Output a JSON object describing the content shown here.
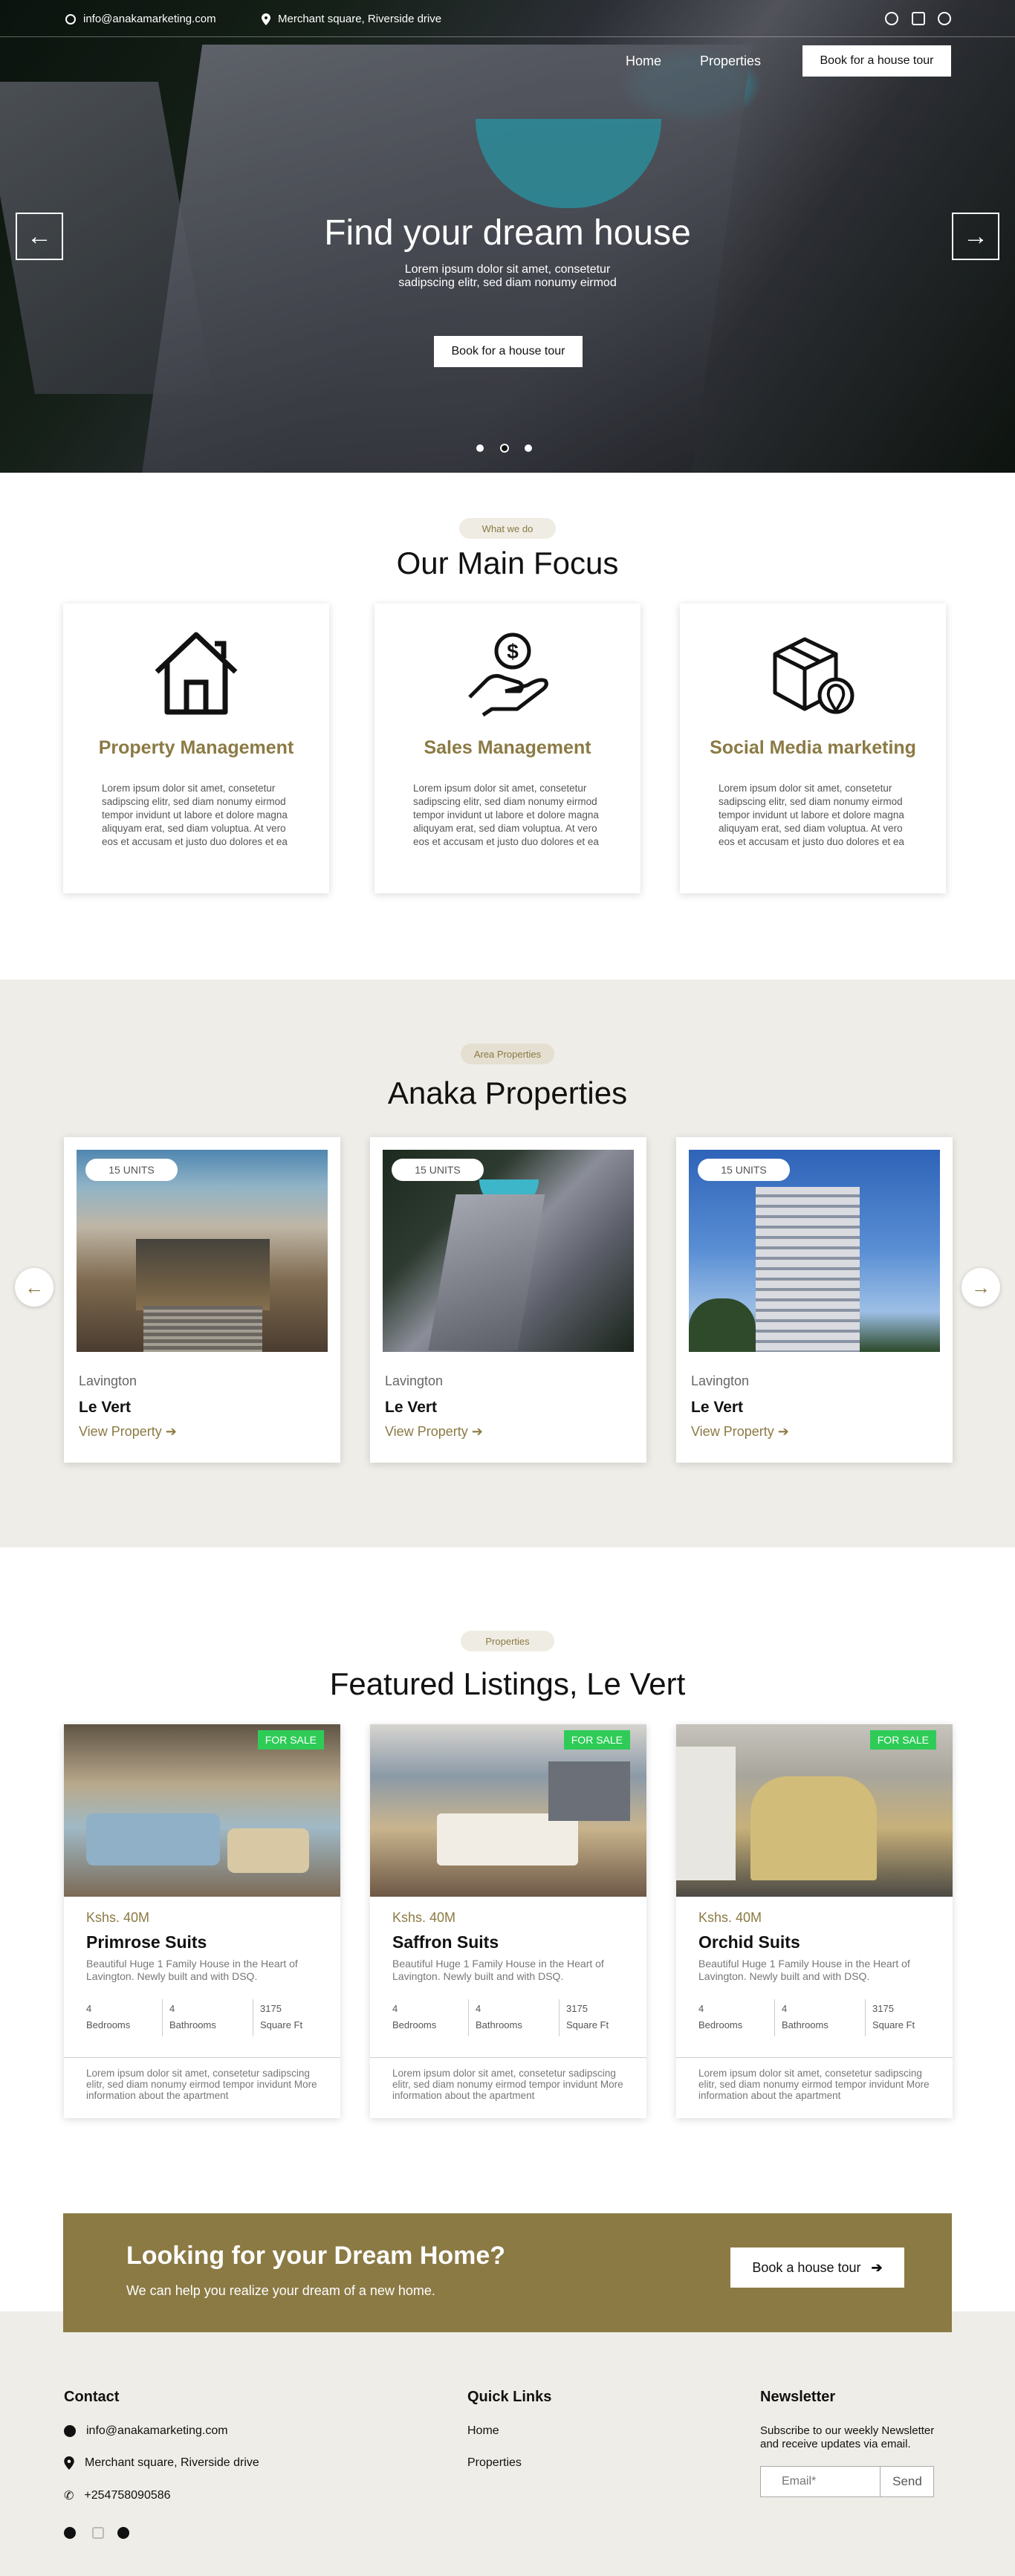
{
  "topbar": {
    "email": "info@anakamarketing.com",
    "address": "Merchant square, Riverside drive",
    "social_icons": [
      "instagram-icon",
      "square-icon",
      "twitter-icon"
    ]
  },
  "nav": {
    "home": "Home",
    "properties": "Properties",
    "tour_button": "Book for a house tour"
  },
  "hero": {
    "title": "Find your dream house",
    "subtitle_line1": "Lorem ipsum dolor sit amet, consetetur",
    "subtitle_line2": "sadipscing elitr, sed diam nonumy eirmod",
    "button": "Book for a house tour",
    "prev_arrow": "←",
    "next_arrow": "→",
    "slides": 3,
    "active_slide": 2
  },
  "focus": {
    "pill": "What we do",
    "heading": "Our Main Focus",
    "cards": [
      {
        "icon": "house-icon",
        "title": "Property Management",
        "text": "Lorem ipsum dolor sit amet, consetetur sadipscing elitr, sed diam nonumy eirmod tempor invidunt ut labore et dolore magna aliquyam erat, sed diam voluptua. At vero eos et accusam et justo duo dolores et ea"
      },
      {
        "icon": "hand-dollar-icon",
        "title": "Sales Management",
        "text": "Lorem ipsum dolor sit amet, consetetur sadipscing elitr, sed diam nonumy eirmod tempor invidunt ut labore et dolore magna aliquyam erat, sed diam voluptua. At vero eos et accusam et justo duo dolores et ea"
      },
      {
        "icon": "box-location-icon",
        "title": "Social Media marketing",
        "text": "Lorem ipsum dolor sit amet, consetetur sadipscing elitr, sed diam nonumy eirmod tempor invidunt ut labore et dolore magna aliquyam erat, sed diam voluptua. At vero eos et accusam et justo duo dolores et ea"
      }
    ]
  },
  "area": {
    "pill": "Area Properties",
    "heading": "Anaka Properties",
    "items": [
      {
        "units": "15 UNITS",
        "location": "Lavington",
        "name": "Le Vert",
        "link": "View Property"
      },
      {
        "units": "15 UNITS",
        "location": "Lavington",
        "name": "Le Vert",
        "link": "View Property"
      },
      {
        "units": "15 UNITS",
        "location": "Lavington",
        "name": "Le Vert",
        "link": "View Property"
      }
    ]
  },
  "featured": {
    "pill": "Properties",
    "heading": "Featured Listings, Le Vert",
    "items": [
      {
        "badge": "FOR SALE",
        "price": "Kshs. 40M",
        "name": "Primrose Suits",
        "desc": "Beautiful Huge 1 Family House in the Heart of Lavington. Newly built and with DSQ.",
        "bedrooms": "4",
        "bedrooms_label": "Bedrooms",
        "bathrooms": "4",
        "bathrooms_label": "Bathrooms",
        "sqft": "3175",
        "sqft_label": "Square Ft",
        "footer": "Lorem ipsum dolor sit amet, consetetur sadipscing elitr, sed diam nonumy eirmod tempor invidunt More information about the apartment"
      },
      {
        "badge": "FOR SALE",
        "price": "Kshs. 40M",
        "name": "Saffron Suits",
        "desc": "Beautiful Huge 1 Family House in the Heart of Lavington. Newly built and with DSQ.",
        "bedrooms": "4",
        "bedrooms_label": "Bedrooms",
        "bathrooms": "4",
        "bathrooms_label": "Bathrooms",
        "sqft": "3175",
        "sqft_label": "Square Ft",
        "footer": "Lorem ipsum dolor sit amet, consetetur sadipscing elitr, sed diam nonumy eirmod tempor invidunt More information about the apartment"
      },
      {
        "badge": "FOR SALE",
        "price": "Kshs. 40M",
        "name": "Orchid Suits",
        "desc": "Beautiful Huge 1 Family House in the Heart of Lavington. Newly built and with DSQ.",
        "bedrooms": "4",
        "bedrooms_label": "Bedrooms",
        "bathrooms": "4",
        "bathrooms_label": "Bathrooms",
        "sqft": "3175",
        "sqft_label": "Square Ft",
        "footer": "Lorem ipsum dolor sit amet, consetetur sadipscing elitr, sed diam nonumy eirmod tempor invidunt More information about the apartment"
      }
    ]
  },
  "cta": {
    "title": "Looking for your Dream Home?",
    "subtitle": "We can help you realize your dream of a new home.",
    "button": "Book a house tour"
  },
  "footer": {
    "contact_heading": "Contact",
    "email": "info@anakamarketing.com",
    "address": "Merchant square, Riverside drive",
    "phone": "+254758090586",
    "links_heading": "Quick Links",
    "link_home": "Home",
    "link_properties": "Properties",
    "newsletter_heading": "Newsletter",
    "newsletter_text_line1": "Subscribe to our weekly Newsletter",
    "newsletter_text_line2": "and receive updates via email.",
    "email_placeholder": "Email*",
    "send": "Send"
  },
  "colors": {
    "accent": "#8b7a44",
    "sale_badge": "#2ecc57",
    "section_bg": "#efede7"
  }
}
